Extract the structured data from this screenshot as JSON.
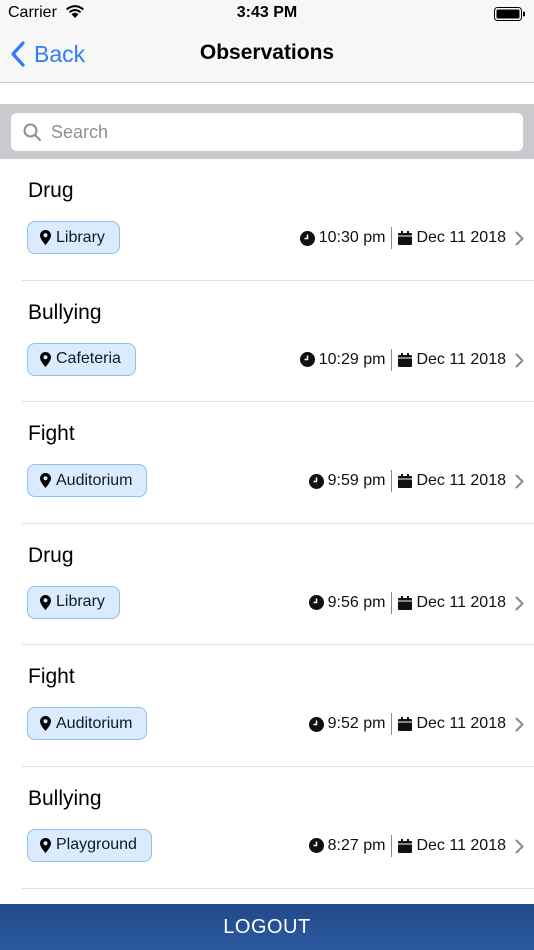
{
  "status_bar": {
    "carrier": "Carrier",
    "time": "3:43 PM"
  },
  "nav": {
    "back_label": "Back",
    "title": "Observations"
  },
  "search": {
    "placeholder": "Search"
  },
  "observations": [
    {
      "type": "Drug",
      "location": "Library",
      "time": "10:30 pm",
      "date": "Dec 11 2018"
    },
    {
      "type": "Bullying",
      "location": "Cafeteria",
      "time": "10:29 pm",
      "date": "Dec 11 2018"
    },
    {
      "type": "Fight",
      "location": "Auditorium",
      "time": "9:59 pm",
      "date": "Dec 11 2018"
    },
    {
      "type": "Drug",
      "location": "Library",
      "time": "9:56 pm",
      "date": "Dec 11 2018"
    },
    {
      "type": "Fight",
      "location": "Auditorium",
      "time": "9:52 pm",
      "date": "Dec 11 2018"
    },
    {
      "type": "Bullying",
      "location": "Playground",
      "time": "8:27 pm",
      "date": "Dec 11 2018"
    }
  ],
  "footer": {
    "logout_label": "LOGOUT"
  },
  "colors": {
    "accent": "#2f7cf6",
    "badge_bg": "#d9ebfc",
    "badge_border": "#8fc0ee",
    "footer_bg": "#2c5aa0"
  }
}
